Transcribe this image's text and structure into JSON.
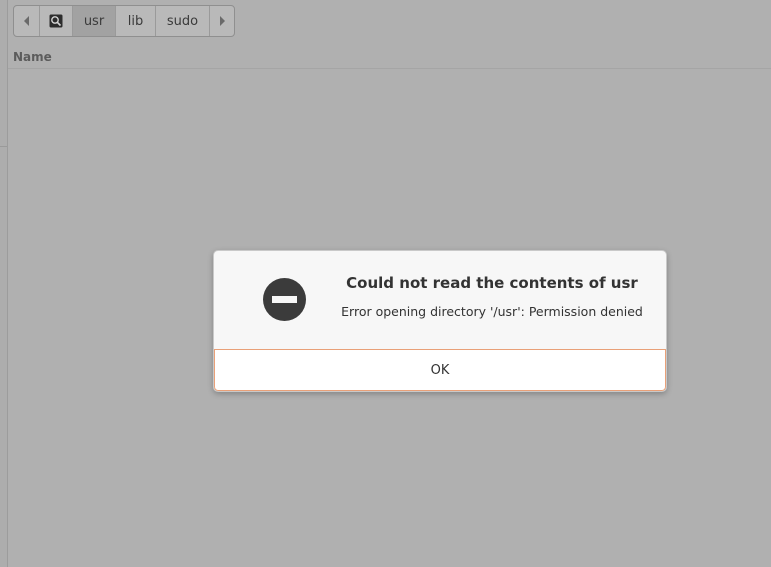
{
  "pathbar": {
    "segments": [
      "usr",
      "lib",
      "sudo"
    ],
    "root_icon": "root-drive-icon",
    "back_icon": "left-arrow-icon",
    "forward_icon": "right-arrow-icon"
  },
  "file_list": {
    "column_name": "Name"
  },
  "dialog": {
    "icon": "error-icon",
    "title": "Could not read the contents of usr",
    "message": "Error opening directory '/usr': Permission denied",
    "ok_label": "OK"
  },
  "colors": {
    "accent_border": "#e9a078",
    "dim_background": "#b0b0b0"
  }
}
